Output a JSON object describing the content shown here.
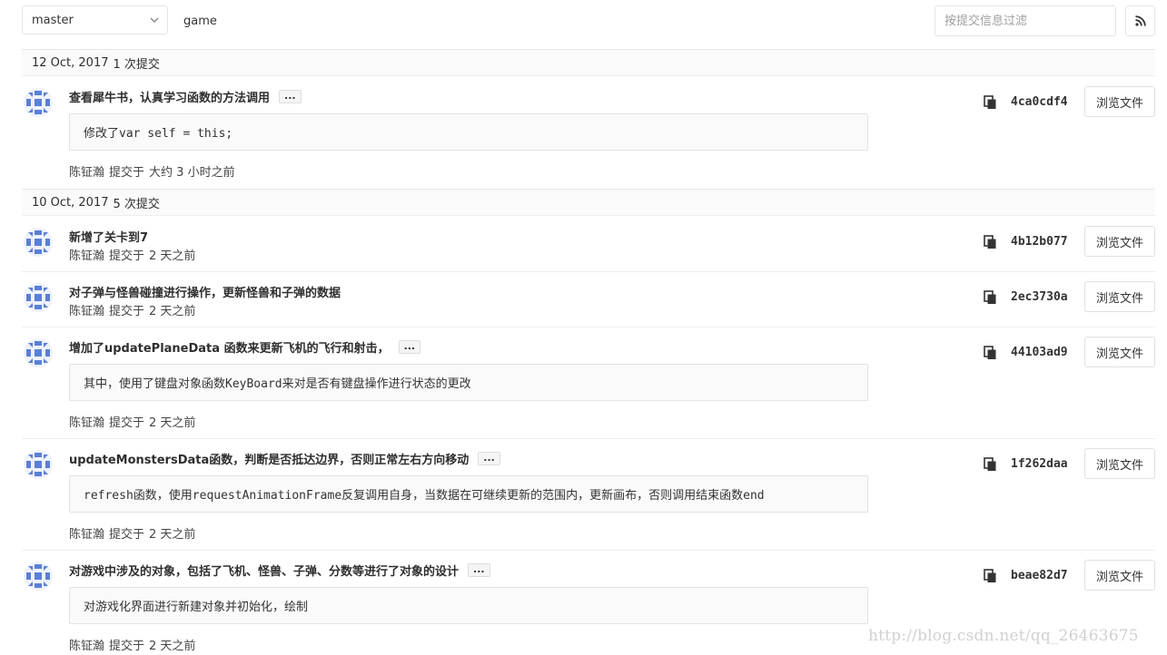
{
  "toolbar": {
    "branch": "master",
    "path": "game",
    "filter_placeholder": "按提交信息过滤",
    "rss_icon": "rss-icon"
  },
  "groups": [
    {
      "date": "12 Oct, 2017",
      "count": "1 次提交",
      "commits": [
        {
          "title": "查看犀牛书，认真学习函数的方法调用",
          "has_more": true,
          "more_label": "...",
          "description": "修改了var self = this;",
          "author": "陈钲瀚",
          "verb": "提交于",
          "time": "大约 3 小时之前",
          "sha": "4ca0cdf4",
          "browse": "浏览文件"
        }
      ]
    },
    {
      "date": "10 Oct, 2017",
      "count": "5 次提交",
      "commits": [
        {
          "title": "新增了关卡到7",
          "author": "陈钲瀚",
          "verb": "提交于",
          "time": "2 天之前",
          "sha": "4b12b077",
          "browse": "浏览文件"
        },
        {
          "title": "对子弹与怪兽碰撞进行操作，更新怪兽和子弹的数据",
          "author": "陈钲瀚",
          "verb": "提交于",
          "time": "2 天之前",
          "sha": "2ec3730a",
          "browse": "浏览文件"
        },
        {
          "title": "增加了updatePlaneData 函数来更新飞机的飞行和射击，",
          "has_more": true,
          "more_label": "...",
          "description": "其中，使用了键盘对象函数KeyBoard来对是否有键盘操作进行状态的更改",
          "author": "陈钲瀚",
          "verb": "提交于",
          "time": "2 天之前",
          "sha": "44103ad9",
          "browse": "浏览文件"
        },
        {
          "title": "updateMonstersData函数，判断是否抵达边界，否则正常左右方向移动",
          "has_more": true,
          "more_label": "...",
          "description": "refresh函数，使用requestAnimationFrame反复调用自身，当数据在可继续更新的范围内，更新画布，否则调用结束函数end",
          "author": "陈钲瀚",
          "verb": "提交于",
          "time": "2 天之前",
          "sha": "1f262daa",
          "browse": "浏览文件"
        },
        {
          "title": "对游戏中涉及的对象，包括了飞机、怪兽、子弹、分数等进行了对象的设计",
          "has_more": true,
          "more_label": "...",
          "description": "对游戏化界面进行新建对象并初始化，绘制",
          "author": "陈钲瀚",
          "verb": "提交于",
          "time": "2 天之前",
          "sha": "beae82d7",
          "browse": "浏览文件"
        }
      ]
    }
  ],
  "watermark": "http://blog.csdn.net/qq_26463675",
  "colors": {
    "avatar_blue": "#5a7fd6",
    "header_bg": "#fafafa",
    "border": "#e5e5e5"
  }
}
